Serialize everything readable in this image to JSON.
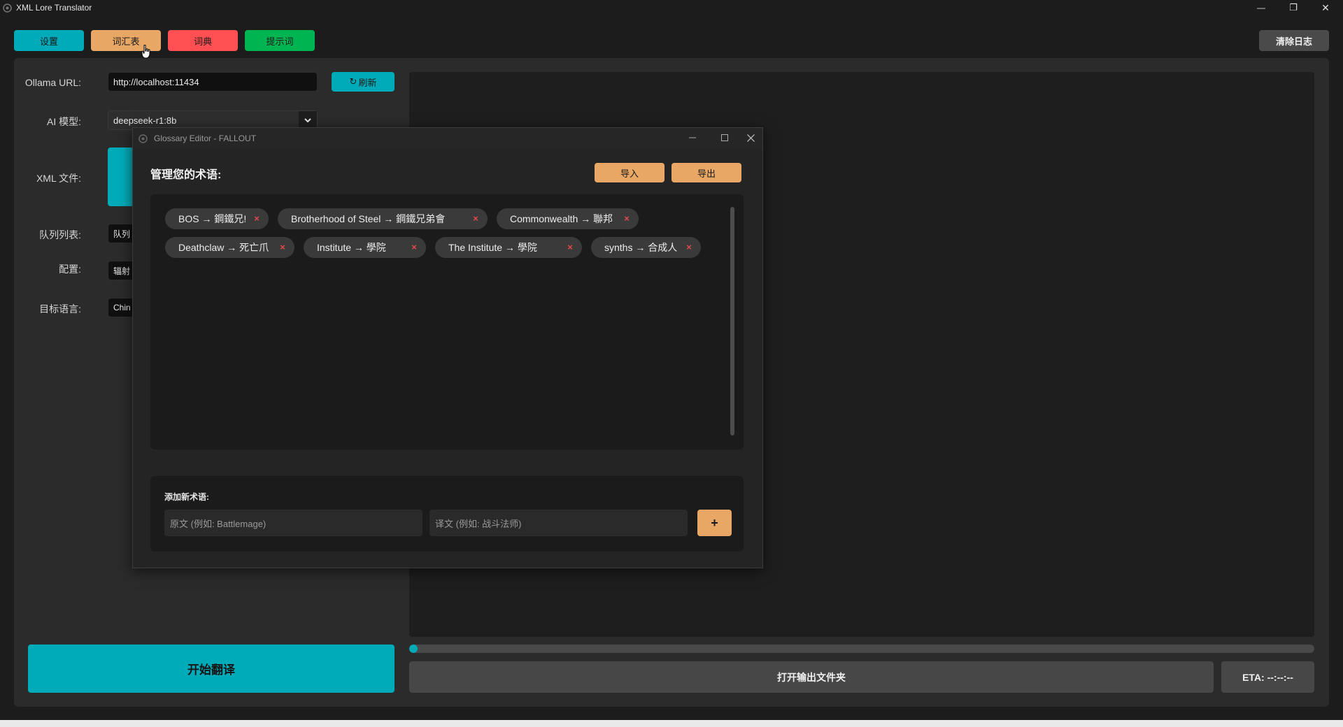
{
  "app": {
    "title": "XML Lore Translator",
    "window_controls": {
      "minimize": "—",
      "restore": "❐",
      "close": "✕"
    }
  },
  "toolbar": {
    "settings_label": "设置",
    "glossary_label": "词汇表",
    "dictionary_label": "词典",
    "prompt_label": "提示词",
    "clear_log_label": "清除日志"
  },
  "form": {
    "ollama_url_label": "Ollama URL:",
    "ollama_url_value": "http://localhost:11434",
    "refresh_label": "刷新",
    "ai_model_label": "AI 模型:",
    "ai_model_value": "deepseek-r1:8b",
    "xml_file_label": "XML 文件:",
    "queue_label": "队列列表:",
    "queue_value": "队列",
    "config_label": "配置:",
    "config_value": "辐射",
    "target_lang_label": "目标语言:",
    "target_lang_value": "Chin"
  },
  "bottom": {
    "start_label": "开始翻译",
    "open_output_label": "打开输出文件夹",
    "eta_label": "ETA: --:--:--",
    "progress": 0.0
  },
  "dialog": {
    "title": "Glossary Editor - FALLOUT",
    "heading": "管理您的术语:",
    "import_label": "导入",
    "export_label": "导出",
    "terms": [
      "BOS → 鋼鐵兄!",
      "Brotherhood of Steel → 鋼鐵兄弟會",
      "Commonwealth → 聯邦",
      "Deathclaw → 死亡爪",
      "Institute → 學院",
      "The Institute → 學院",
      "synths → 合成人"
    ],
    "remove_glyph": "×",
    "add_section_label": "添加新术语:",
    "source_placeholder": "原文 (例如: Battlemage)",
    "target_placeholder": "译文 (例如: 战斗法师)",
    "add_button_label": "+"
  },
  "colors": {
    "teal": "#00abb9",
    "orange": "#e8a765",
    "red": "#ff4f52",
    "green": "#00b551",
    "background": "#1c1c1c",
    "panel": "#2b2b2b"
  }
}
